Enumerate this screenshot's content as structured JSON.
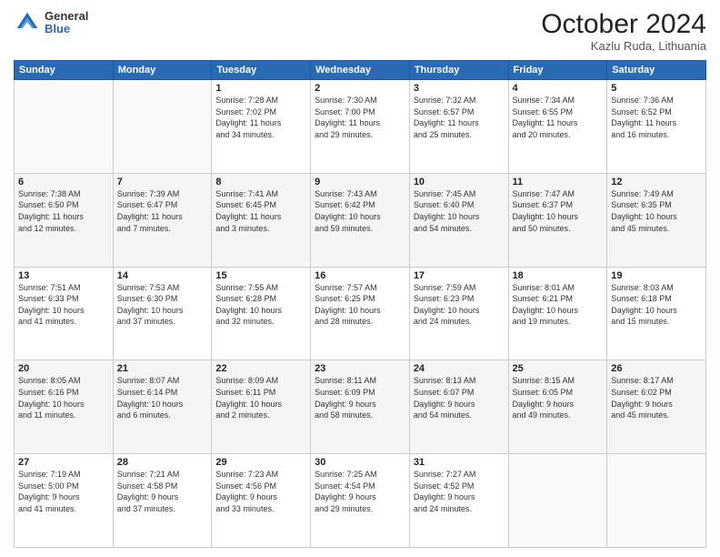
{
  "logo": {
    "general": "General",
    "blue": "Blue"
  },
  "header": {
    "month": "October 2024",
    "location": "Kazlu Ruda, Lithuania"
  },
  "days_of_week": [
    "Sunday",
    "Monday",
    "Tuesday",
    "Wednesday",
    "Thursday",
    "Friday",
    "Saturday"
  ],
  "weeks": [
    [
      {
        "day": "",
        "info": ""
      },
      {
        "day": "",
        "info": ""
      },
      {
        "day": "1",
        "info": "Sunrise: 7:28 AM\nSunset: 7:02 PM\nDaylight: 11 hours\nand 34 minutes."
      },
      {
        "day": "2",
        "info": "Sunrise: 7:30 AM\nSunset: 7:00 PM\nDaylight: 11 hours\nand 29 minutes."
      },
      {
        "day": "3",
        "info": "Sunrise: 7:32 AM\nSunset: 6:57 PM\nDaylight: 11 hours\nand 25 minutes."
      },
      {
        "day": "4",
        "info": "Sunrise: 7:34 AM\nSunset: 6:55 PM\nDaylight: 11 hours\nand 20 minutes."
      },
      {
        "day": "5",
        "info": "Sunrise: 7:36 AM\nSunset: 6:52 PM\nDaylight: 11 hours\nand 16 minutes."
      }
    ],
    [
      {
        "day": "6",
        "info": "Sunrise: 7:38 AM\nSunset: 6:50 PM\nDaylight: 11 hours\nand 12 minutes."
      },
      {
        "day": "7",
        "info": "Sunrise: 7:39 AM\nSunset: 6:47 PM\nDaylight: 11 hours\nand 7 minutes."
      },
      {
        "day": "8",
        "info": "Sunrise: 7:41 AM\nSunset: 6:45 PM\nDaylight: 11 hours\nand 3 minutes."
      },
      {
        "day": "9",
        "info": "Sunrise: 7:43 AM\nSunset: 6:42 PM\nDaylight: 10 hours\nand 59 minutes."
      },
      {
        "day": "10",
        "info": "Sunrise: 7:45 AM\nSunset: 6:40 PM\nDaylight: 10 hours\nand 54 minutes."
      },
      {
        "day": "11",
        "info": "Sunrise: 7:47 AM\nSunset: 6:37 PM\nDaylight: 10 hours\nand 50 minutes."
      },
      {
        "day": "12",
        "info": "Sunrise: 7:49 AM\nSunset: 6:35 PM\nDaylight: 10 hours\nand 45 minutes."
      }
    ],
    [
      {
        "day": "13",
        "info": "Sunrise: 7:51 AM\nSunset: 6:33 PM\nDaylight: 10 hours\nand 41 minutes."
      },
      {
        "day": "14",
        "info": "Sunrise: 7:53 AM\nSunset: 6:30 PM\nDaylight: 10 hours\nand 37 minutes."
      },
      {
        "day": "15",
        "info": "Sunrise: 7:55 AM\nSunset: 6:28 PM\nDaylight: 10 hours\nand 32 minutes."
      },
      {
        "day": "16",
        "info": "Sunrise: 7:57 AM\nSunset: 6:25 PM\nDaylight: 10 hours\nand 28 minutes."
      },
      {
        "day": "17",
        "info": "Sunrise: 7:59 AM\nSunset: 6:23 PM\nDaylight: 10 hours\nand 24 minutes."
      },
      {
        "day": "18",
        "info": "Sunrise: 8:01 AM\nSunset: 6:21 PM\nDaylight: 10 hours\nand 19 minutes."
      },
      {
        "day": "19",
        "info": "Sunrise: 8:03 AM\nSunset: 6:18 PM\nDaylight: 10 hours\nand 15 minutes."
      }
    ],
    [
      {
        "day": "20",
        "info": "Sunrise: 8:05 AM\nSunset: 6:16 PM\nDaylight: 10 hours\nand 11 minutes."
      },
      {
        "day": "21",
        "info": "Sunrise: 8:07 AM\nSunset: 6:14 PM\nDaylight: 10 hours\nand 6 minutes."
      },
      {
        "day": "22",
        "info": "Sunrise: 8:09 AM\nSunset: 6:11 PM\nDaylight: 10 hours\nand 2 minutes."
      },
      {
        "day": "23",
        "info": "Sunrise: 8:11 AM\nSunset: 6:09 PM\nDaylight: 9 hours\nand 58 minutes."
      },
      {
        "day": "24",
        "info": "Sunrise: 8:13 AM\nSunset: 6:07 PM\nDaylight: 9 hours\nand 54 minutes."
      },
      {
        "day": "25",
        "info": "Sunrise: 8:15 AM\nSunset: 6:05 PM\nDaylight: 9 hours\nand 49 minutes."
      },
      {
        "day": "26",
        "info": "Sunrise: 8:17 AM\nSunset: 6:02 PM\nDaylight: 9 hours\nand 45 minutes."
      }
    ],
    [
      {
        "day": "27",
        "info": "Sunrise: 7:19 AM\nSunset: 5:00 PM\nDaylight: 9 hours\nand 41 minutes."
      },
      {
        "day": "28",
        "info": "Sunrise: 7:21 AM\nSunset: 4:58 PM\nDaylight: 9 hours\nand 37 minutes."
      },
      {
        "day": "29",
        "info": "Sunrise: 7:23 AM\nSunset: 4:56 PM\nDaylight: 9 hours\nand 33 minutes."
      },
      {
        "day": "30",
        "info": "Sunrise: 7:25 AM\nSunset: 4:54 PM\nDaylight: 9 hours\nand 29 minutes."
      },
      {
        "day": "31",
        "info": "Sunrise: 7:27 AM\nSunset: 4:52 PM\nDaylight: 9 hours\nand 24 minutes."
      },
      {
        "day": "",
        "info": ""
      },
      {
        "day": "",
        "info": ""
      }
    ]
  ]
}
